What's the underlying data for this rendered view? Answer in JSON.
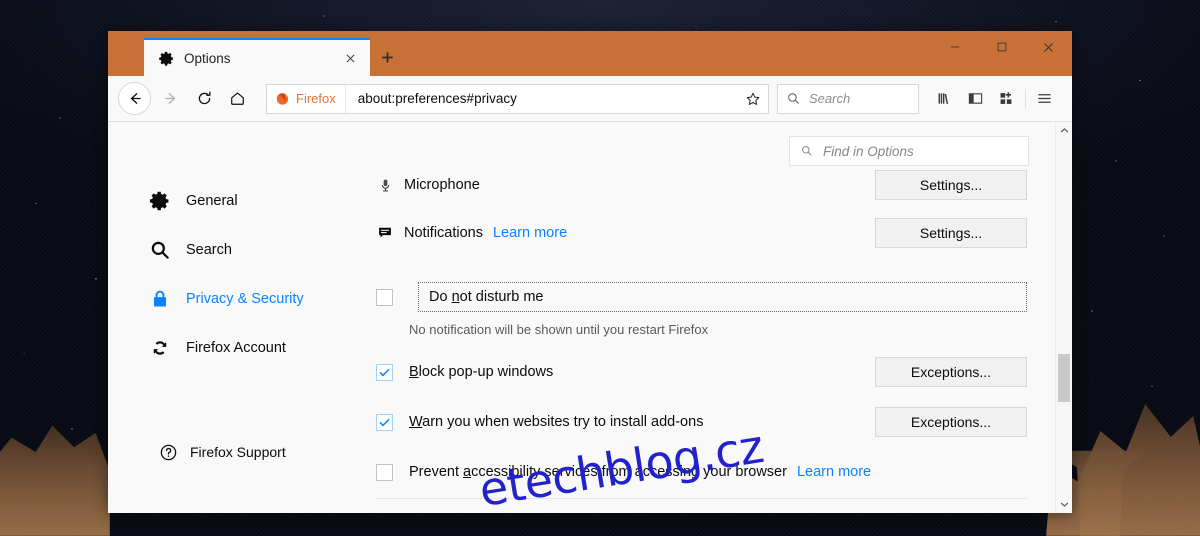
{
  "window": {
    "tab": {
      "title": "Options",
      "icon": "gear-icon",
      "close_label": "×",
      "new_tab_label": "+"
    },
    "controls": {
      "minimize": "─",
      "maximize": "□",
      "close": "✕"
    }
  },
  "toolbar": {
    "back_label": "←",
    "forward_label": "→",
    "reload_label": "⟳",
    "home_label": "⌂",
    "identity_label": "Firefox",
    "url": "about:preferences#privacy",
    "bookmark_label": "☆",
    "search_placeholder": "Search",
    "library_label": "library-icon",
    "sidebar_label": "sidebar-icon",
    "addons_label": "addons-icon",
    "menu_label": "hamburger-icon"
  },
  "prefs": {
    "find_placeholder": "Find in Options",
    "sidebar": {
      "items": [
        {
          "label": "General",
          "icon": "gear-icon",
          "active": false
        },
        {
          "label": "Search",
          "icon": "magnifier-icon",
          "active": false
        },
        {
          "label": "Privacy & Security",
          "icon": "lock-icon",
          "active": true
        },
        {
          "label": "Firefox Account",
          "icon": "sync-icon",
          "active": false
        }
      ],
      "support": {
        "label": "Firefox Support",
        "icon": "help-icon"
      }
    },
    "permissions": [
      {
        "label": "Microphone",
        "icon": "microphone-icon",
        "button": "Settings...",
        "button_accel": "t",
        "learn_more": null
      },
      {
        "label": "Notifications",
        "icon": "notification-icon",
        "button": "Settings...",
        "button_accel": "t",
        "learn_more": "Learn more"
      }
    ],
    "do_not_disturb": {
      "label_pre": "Do ",
      "label_accel": "n",
      "label_post": "ot disturb me",
      "checked": false,
      "note": "No notification will be shown until you restart Firefox"
    },
    "checkboxes": [
      {
        "label_pre": "",
        "label_accel": "B",
        "label_post": "lock pop-up windows",
        "checked": true,
        "button": "Exceptions...",
        "button_accel": "E",
        "learn_more": null
      },
      {
        "label_pre": "",
        "label_accel": "W",
        "label_post": "arn you when websites try to install add-ons",
        "checked": true,
        "button": "Exceptions...",
        "button_accel": "E",
        "learn_more": null
      },
      {
        "label_pre": "Prevent ",
        "label_accel": "a",
        "label_post": "ccessibility services from accessing your browser",
        "checked": false,
        "button": null,
        "button_accel": null,
        "learn_more": "Learn more"
      }
    ],
    "scrollbar": {
      "up_label": "⌃",
      "down_label": "⌄"
    }
  },
  "watermark": {
    "text": "etechblog.cz"
  },
  "colors": {
    "titlebar": "#c87137",
    "accent": "#0a84ff",
    "identity": "#d77836",
    "link": "#0a84ff"
  }
}
